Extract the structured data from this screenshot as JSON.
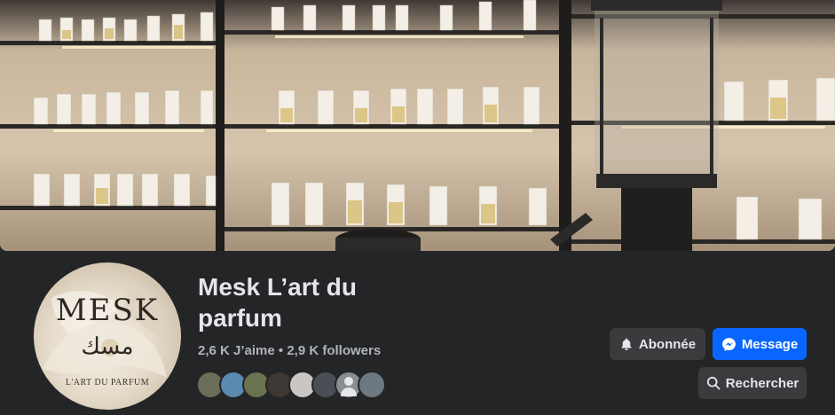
{
  "page": {
    "name": "Mesk L’art du parfum",
    "likes": "2,6 K J’aime",
    "separator": " • ",
    "followers_count": "2,9 K followers"
  },
  "avatar": {
    "brand": "MESK",
    "arabic": "مسك",
    "tagline": "L'ART DU PARFUM"
  },
  "actions": {
    "follow_label": "Abonnée",
    "message_label": "Message",
    "search_label": "Rechercher"
  },
  "icons": {
    "follow": "bell-icon",
    "message": "messenger-icon",
    "search": "search-icon"
  },
  "follower_avatars": [
    {
      "color": "#6b6f5a"
    },
    {
      "color": "#5a8ab0"
    },
    {
      "color": "#6a7350"
    },
    {
      "color": "#3d3834"
    },
    {
      "color": "#c9c6c4"
    },
    {
      "color": "#4b4f55"
    },
    {
      "color": "default"
    },
    {
      "color": "#6e7881"
    }
  ],
  "colors": {
    "background": "#242526",
    "primary": "#0866ff",
    "secondary_button": "#3a3b3c",
    "text_primary": "#e4e6eb",
    "text_secondary": "#b0b3b8"
  }
}
